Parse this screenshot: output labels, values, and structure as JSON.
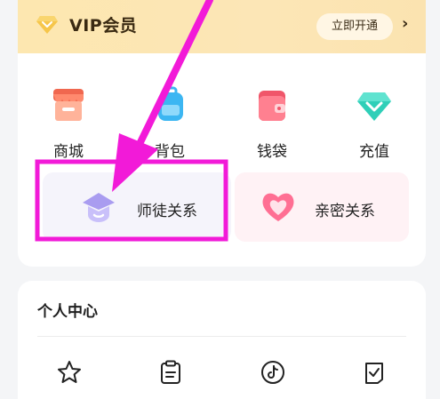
{
  "vip": {
    "title": "VIP会员",
    "open_label": "立即开通",
    "chevron": "›"
  },
  "grid": [
    {
      "label": "商城",
      "icon": "shop-icon"
    },
    {
      "label": "背包",
      "icon": "backpack-icon"
    },
    {
      "label": "钱袋",
      "icon": "wallet-icon"
    },
    {
      "label": "充值",
      "icon": "diamond-icon"
    }
  ],
  "relations": {
    "master_label": "师徒关系",
    "master_icon": "graduation-cap-icon",
    "intimate_label": "亲密关系",
    "intimate_icon": "heart-icon"
  },
  "center": {
    "title": "个人中心",
    "icons": [
      "star-icon",
      "clipboard-icon",
      "tiktok-icon",
      "checkbox-icon"
    ]
  },
  "colors": {
    "annotation": "#f21ad8",
    "vip_gold": "#f6c64a"
  }
}
